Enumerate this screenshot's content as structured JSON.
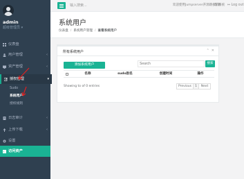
{
  "user": {
    "name": "admin",
    "role": "超级管理员 ▾"
  },
  "sidebar": {
    "items": [
      {
        "label": "仪表盘",
        "arrow": ""
      },
      {
        "label": "用户管理",
        "arrow": "‹"
      },
      {
        "label": "资产管理",
        "arrow": "‹"
      },
      {
        "label": "授权管理",
        "arrow": "▾"
      },
      {
        "label": "日志审计",
        "arrow": "‹"
      },
      {
        "label": "上传下载",
        "arrow": "‹"
      },
      {
        "label": "设置",
        "arrow": ""
      }
    ],
    "subitems": [
      "Sudo",
      "系统用户",
      "授权规则"
    ],
    "bottom": "访问资产"
  },
  "topbar": {
    "search_placeholder": "输入搜索...",
    "welcome": "欢迎使用Jumpserver开源跳板机系统",
    "help": "帮助",
    "logout": "↦ Log out"
  },
  "header": {
    "title": "系统用户",
    "breadcrumb": [
      "仪表盘",
      "系统用户管理",
      "查看系统用户"
    ]
  },
  "panel": {
    "title": "所有系统用户",
    "tools": [
      "⌃",
      "✕"
    ],
    "add_label": "添加系统用户",
    "search_placeholder": "Search",
    "search_button": "搜索",
    "columns": [
      "",
      "名称",
      "sudo别名",
      "创建时间",
      "操作"
    ],
    "showing": "Showing to of 0 entries",
    "pagination": {
      "prev": "Previous",
      "page": "1",
      "next": "Next"
    }
  },
  "colors": {
    "sidebar": "#2f4050",
    "accent": "#1ab394"
  }
}
